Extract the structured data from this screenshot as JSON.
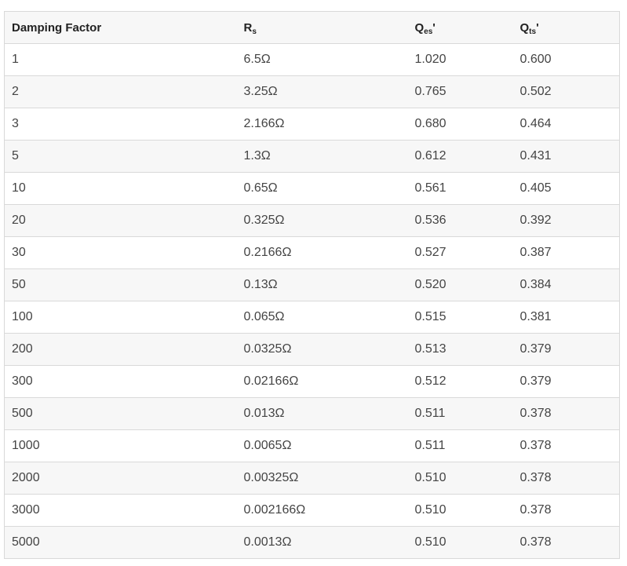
{
  "table": {
    "headers": [
      {
        "main": "Damping Factor",
        "sub": "",
        "suffix": ""
      },
      {
        "main": "R",
        "sub": "s",
        "suffix": ""
      },
      {
        "main": "Q",
        "sub": "es",
        "suffix": "'"
      },
      {
        "main": "Q",
        "sub": "ts",
        "suffix": "'"
      }
    ],
    "rows": [
      [
        "1",
        "6.5Ω",
        "1.020",
        "0.600"
      ],
      [
        "2",
        "3.25Ω",
        "0.765",
        "0.502"
      ],
      [
        "3",
        "2.166Ω",
        "0.680",
        "0.464"
      ],
      [
        "5",
        "1.3Ω",
        "0.612",
        "0.431"
      ],
      [
        "10",
        "0.65Ω",
        "0.561",
        "0.405"
      ],
      [
        "20",
        "0.325Ω",
        "0.536",
        "0.392"
      ],
      [
        "30",
        "0.2166Ω",
        "0.527",
        "0.387"
      ],
      [
        "50",
        "0.13Ω",
        "0.520",
        "0.384"
      ],
      [
        "100",
        "0.065Ω",
        "0.515",
        "0.381"
      ],
      [
        "200",
        "0.0325Ω",
        "0.513",
        "0.379"
      ],
      [
        "300",
        "0.02166Ω",
        "0.512",
        "0.379"
      ],
      [
        "500",
        "0.013Ω",
        "0.511",
        "0.378"
      ],
      [
        "1000",
        "0.0065Ω",
        "0.511",
        "0.378"
      ],
      [
        "2000",
        "0.00325Ω",
        "0.510",
        "0.378"
      ],
      [
        "3000",
        "0.002166Ω",
        "0.510",
        "0.378"
      ],
      [
        "5000",
        "0.0013Ω",
        "0.510",
        "0.378"
      ]
    ]
  }
}
